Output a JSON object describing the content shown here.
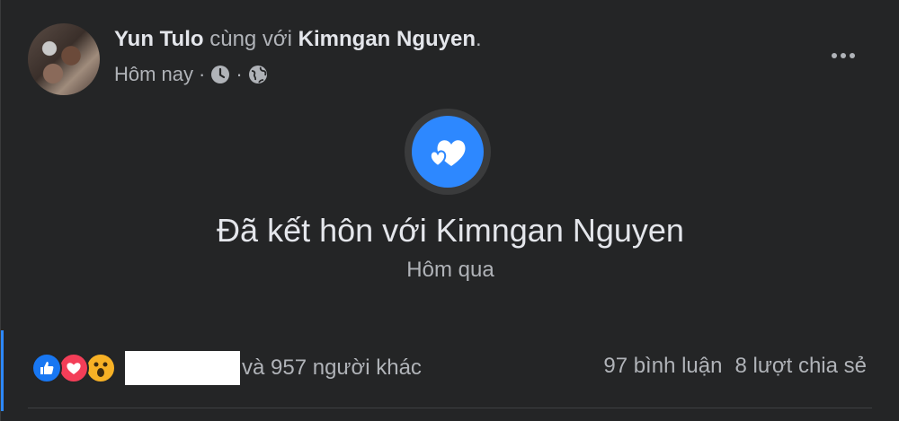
{
  "post": {
    "author": "Yun Tulo",
    "with_text": "cùng với",
    "tagged": "Kimngan Nguyen",
    "period": ".",
    "time": "Hôm nay",
    "separator": "·"
  },
  "life_event": {
    "title": "Đã kết hôn với Kimngan Nguyen",
    "date": "Hôm qua",
    "icon": "hearts-icon"
  },
  "footer": {
    "reactions": [
      "like-icon",
      "love-icon",
      "wow-icon"
    ],
    "others": "và 957 người khác",
    "comments": "97 bình luận",
    "shares": "8 lượt chia sẻ"
  },
  "colors": {
    "accent": "#2d88ff",
    "like": "#1877f2",
    "love": "#f33e58",
    "wow": "#f7b125"
  }
}
